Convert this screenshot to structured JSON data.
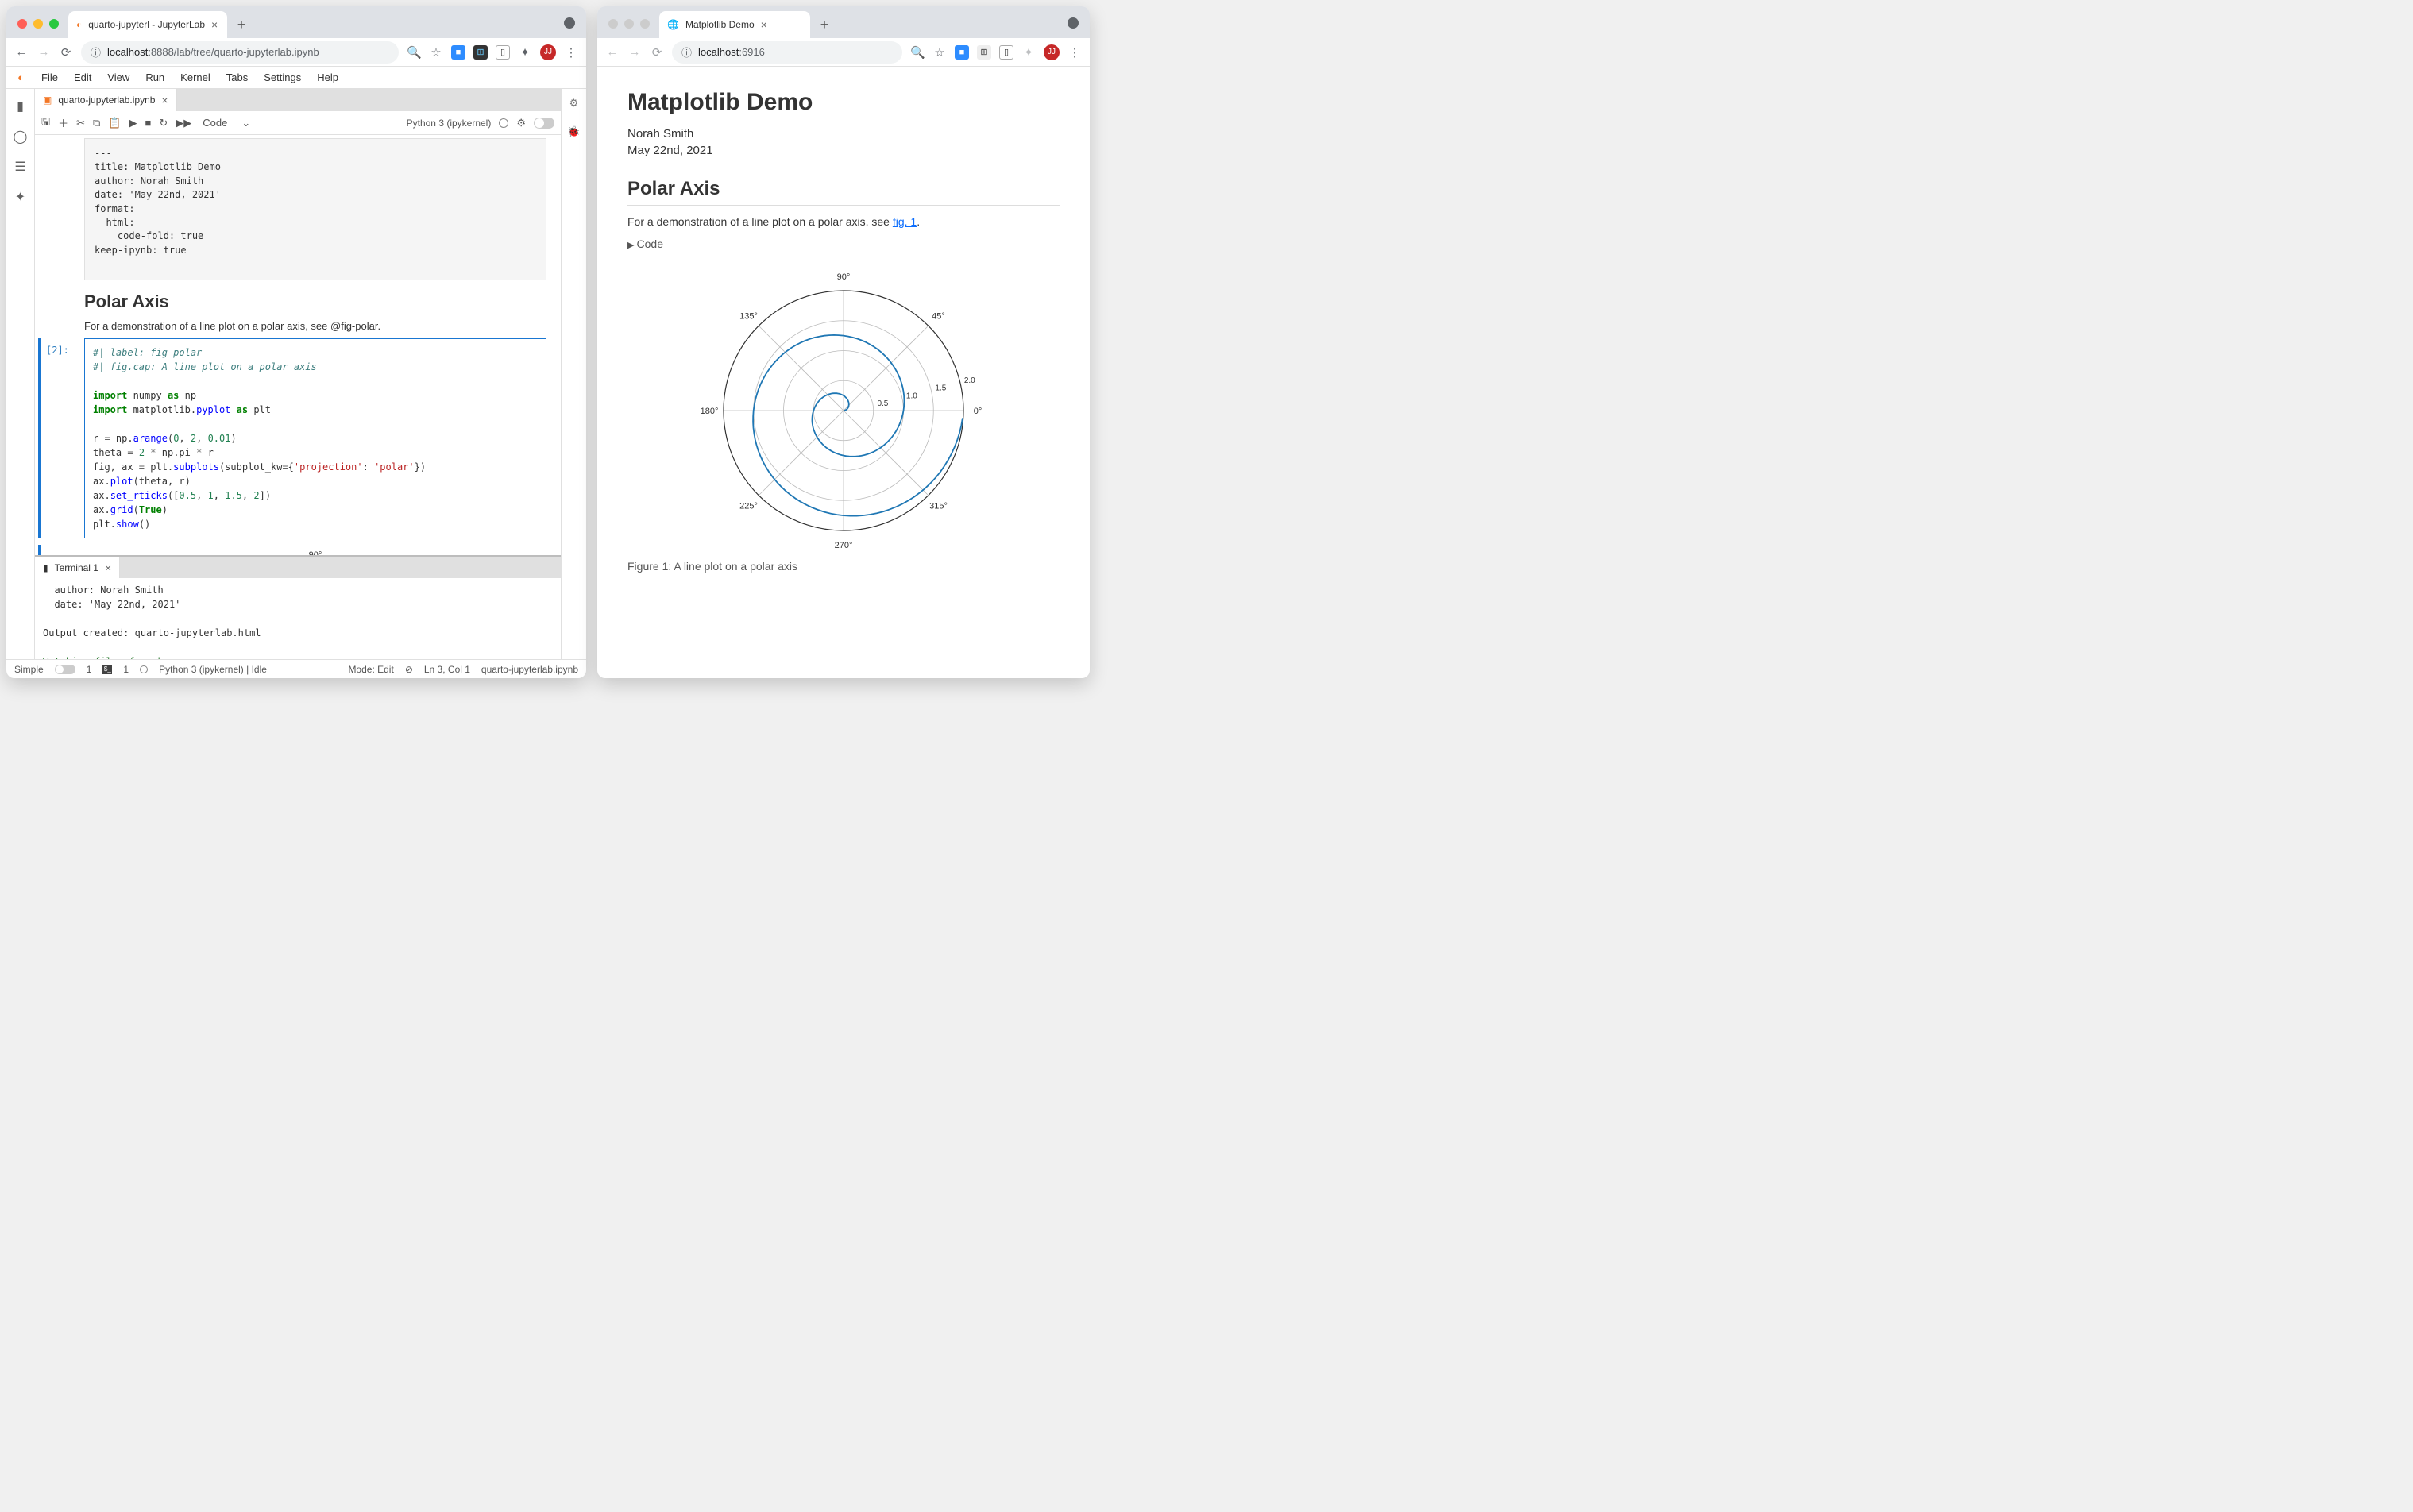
{
  "left": {
    "tab_title": "quarto-jupyterl - JupyterLab",
    "url_host": "localhost",
    "url_path": ":8888/lab/tree/quarto-jupyterlab.ipynb",
    "avatar": "JJ",
    "menu": [
      "File",
      "Edit",
      "View",
      "Run",
      "Kernel",
      "Tabs",
      "Settings",
      "Help"
    ],
    "file_tab": "quarto-jupyterlab.ipynb",
    "cell_type_selector": "Code",
    "kernel_label": "Python 3 (ipykernel)",
    "raw_cell": "---\ntitle: Matplotlib Demo\nauthor: Norah Smith\ndate: 'May 22nd, 2021'\nformat:\n  html:\n    code-fold: true\nkeep-ipynb: true\n---",
    "md_heading": "Polar Axis",
    "md_text": "For a demonstration of a line plot on a polar axis, see @fig-polar.",
    "code_prompt": "[2]:",
    "terminal_tab": "Terminal 1",
    "terminal_lines": [
      "  author: Norah Smith",
      "  date: 'May 22nd, 2021'",
      "",
      "Output created: quarto-jupyterlab.html",
      "",
      "Watching files for changes"
    ],
    "status": {
      "simple": "Simple",
      "counts1": "1",
      "counts2": "1",
      "kernel": "Python 3 (ipykernel) | Idle",
      "mode": "Mode: Edit",
      "ln": "Ln 3, Col 1",
      "path": "quarto-jupyterlab.ipynb"
    }
  },
  "right": {
    "tab_title": "Matplotlib Demo",
    "url_host": "localhost",
    "url_path": ":6916",
    "avatar": "JJ",
    "h1": "Matplotlib Demo",
    "author": "Norah Smith",
    "date": "May 22nd, 2021",
    "h2": "Polar Axis",
    "para_pre": "For a demonstration of a line plot on a polar axis, see ",
    "para_link": "fig. 1",
    "para_post": ".",
    "code_fold": "Code",
    "caption": "Figure 1: A line plot on a polar axis"
  },
  "chart_data": {
    "type": "polar-line",
    "r_ticks": [
      0.5,
      1.0,
      1.5,
      2.0
    ],
    "theta_ticks_deg": [
      0,
      45,
      90,
      135,
      180,
      225,
      270,
      315
    ],
    "r_range": [
      0,
      2
    ],
    "spiral": {
      "r_start": 0,
      "r_end": 2,
      "r_step": 0.01,
      "theta_formula": "2 * pi * r"
    },
    "grid": true
  }
}
